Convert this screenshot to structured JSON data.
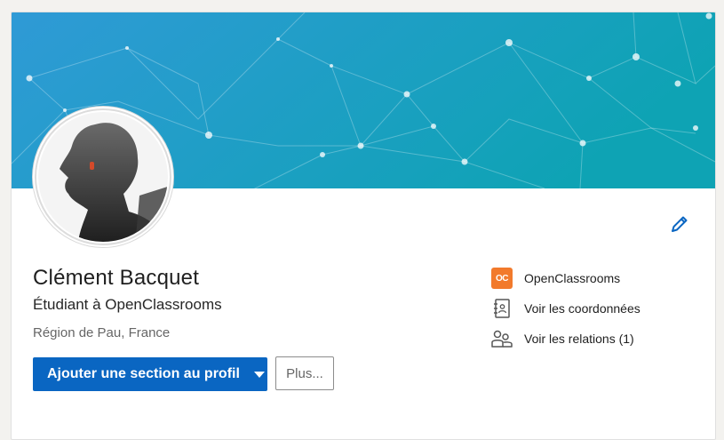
{
  "profile": {
    "name": "Clément Bacquet",
    "headline": "Étudiant à OpenClassrooms",
    "location": "Région de Pau, France"
  },
  "actions": {
    "add_section_label": "Ajouter une section au profil",
    "more_label": "Plus..."
  },
  "sidebar": {
    "company": {
      "label": "OpenClassrooms",
      "logo_text": "OC",
      "icon": "openclassrooms-logo"
    },
    "contact": {
      "label": "Voir les coordonnées",
      "icon": "address-book-icon"
    },
    "connections": {
      "label": "Voir les relations (1)",
      "icon": "people-icon"
    }
  },
  "colors": {
    "primary": "#0a66c2",
    "banner_start": "#2e9bd6",
    "banner_end": "#0fa3b5",
    "company_logo": "#f27a2c"
  }
}
